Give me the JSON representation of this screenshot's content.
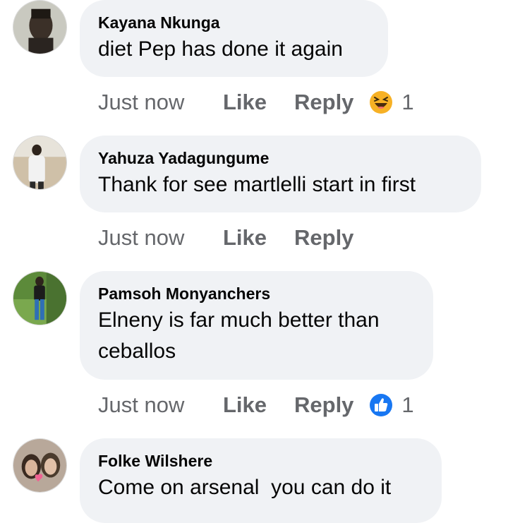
{
  "comments": [
    {
      "author": "Kayana Nkunga",
      "text": "diet Pep has done it again",
      "time": "Just now",
      "like_label": "Like",
      "reply_label": "Reply",
      "reaction_icon": "haha-laughing-emoji-icon",
      "reaction_count": "1"
    },
    {
      "author": "Yahuza Yadagungume",
      "text": "Thank for see martlelli start in first",
      "time": "Just now",
      "like_label": "Like",
      "reply_label": "Reply"
    },
    {
      "author": "Pamsoh Monyanchers",
      "text_lines": [
        "Elneny is far much better than",
        "ceballos"
      ],
      "time": "Just now",
      "like_label": "Like",
      "reply_label": "Reply",
      "reaction_icon": "like-thumbs-up-icon",
      "reaction_count": "1"
    },
    {
      "author": "Folke Wilshere",
      "text": "Come on arsenal  you can do it"
    }
  ],
  "colors": {
    "bubble_bg": "#f0f2f5",
    "text": "#050505",
    "meta_text": "#65676b",
    "like_blue": "#1877f2",
    "haha_yellow": "#f7b125"
  }
}
